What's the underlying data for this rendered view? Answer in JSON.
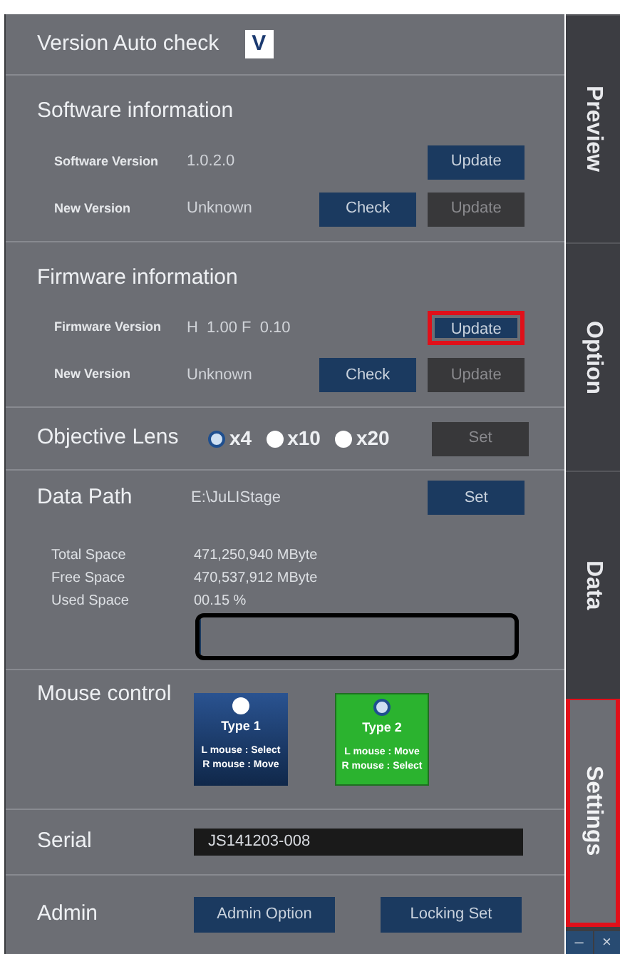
{
  "auto_check": {
    "label": "Version Auto check",
    "checked": true,
    "mark": "V"
  },
  "software": {
    "title": "Software information",
    "rows": [
      {
        "label": "Software Version",
        "value": "1.0.2.0",
        "buttons": [
          {
            "label": "Update",
            "disabled": false,
            "highlighted": false
          }
        ]
      },
      {
        "label": "New Version",
        "value": "Unknown",
        "buttons": [
          {
            "label": "Check",
            "disabled": false,
            "highlighted": false
          },
          {
            "label": "Update",
            "disabled": true,
            "highlighted": false
          }
        ]
      }
    ]
  },
  "firmware": {
    "title": "Firmware information",
    "rows": [
      {
        "label": "Firmware Version",
        "value": "H  1.00 F  0.10",
        "buttons": [
          {
            "label": "Update",
            "disabled": false,
            "highlighted": true
          }
        ]
      },
      {
        "label": "New Version",
        "value": "Unknown",
        "buttons": [
          {
            "label": "Check",
            "disabled": false,
            "highlighted": false
          },
          {
            "label": "Update",
            "disabled": true,
            "highlighted": false
          }
        ]
      }
    ]
  },
  "objective_lens": {
    "label": "Objective Lens",
    "options": [
      {
        "label": "x4",
        "selected": true
      },
      {
        "label": "x10",
        "selected": false
      },
      {
        "label": "x20",
        "selected": false
      }
    ],
    "button": {
      "label": "Set",
      "disabled": true
    }
  },
  "data_path": {
    "label": "Data Path",
    "value": "E:\\JuLIStage",
    "button": {
      "label": "Set",
      "disabled": false
    },
    "stats": [
      {
        "label": "Total Space",
        "value": "471,250,940 MByte"
      },
      {
        "label": "Free Space",
        "value": "470,537,912 MByte"
      },
      {
        "label": "Used Space",
        "value": "00.15 %"
      }
    ],
    "level": 0.0015
  },
  "mouse_control": {
    "label": "Mouse control",
    "types": [
      {
        "title": "Type 1",
        "lines": [
          "L mouse : Select",
          "R mouse : Move"
        ],
        "selected": false
      },
      {
        "title": "Type 2",
        "lines": [
          "L mouse : Move",
          "R mouse : Select"
        ],
        "selected": true
      }
    ]
  },
  "serial": {
    "label": "Serial",
    "value": "JS141203-008"
  },
  "admin": {
    "label": "Admin",
    "buttons": [
      "Admin Option",
      "Locking Set"
    ]
  },
  "tabs": [
    {
      "label": "Preview",
      "selected": false,
      "highlighted": false
    },
    {
      "label": "Option",
      "selected": false,
      "highlighted": false
    },
    {
      "label": "Data",
      "selected": false,
      "highlighted": false
    },
    {
      "label": "Settings",
      "selected": true,
      "highlighted": true
    }
  ],
  "window_controls": [
    "–",
    "×"
  ]
}
